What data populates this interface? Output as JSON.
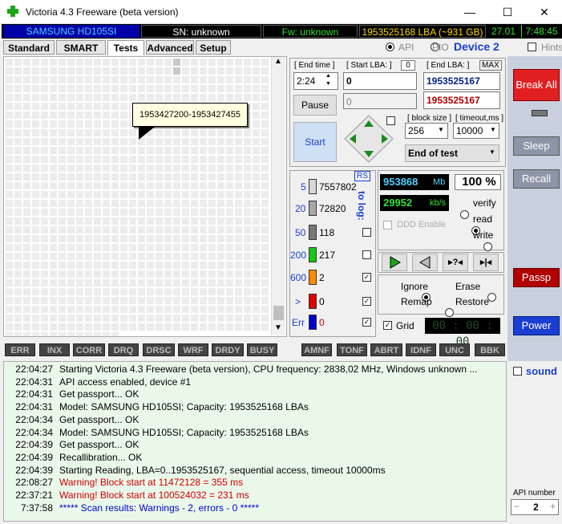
{
  "window": {
    "title": "Victoria 4.3 Freeware (beta version)",
    "minimize": "—",
    "maximize": "☐",
    "close": "✕"
  },
  "info": {
    "model": "SAMSUNG HD105SI",
    "serial": "SN: unknown",
    "firmware": "Fw: unknown",
    "capacity": "1953525168 LBA (~931 GB)",
    "version": "27.01",
    "time": "7:48:45"
  },
  "tabs": [
    "Standard",
    "SMART",
    "Tests",
    "Advanced",
    "Setup"
  ],
  "options": {
    "api": "API",
    "pio": "PIO",
    "device": "Device 2",
    "hints": "Hints"
  },
  "map": {
    "tooltip": "1953427200-1953427455"
  },
  "controls": {
    "end_time_label": "[ End time ]",
    "end_time": "2:24",
    "start_lba_label": "[ Start LBA: ]",
    "start_lba_sub": "0",
    "start_lba": "0",
    "end_lba_label": "[ End LBA: ]",
    "max_label": "MAX",
    "end_lba": "1953525167",
    "pause": "Pause",
    "current_lba": "0",
    "current_end": "1953525167",
    "start": "Start",
    "block_size_label": "[ block size ]",
    "block_size": "256",
    "timeout_label": "[ timeout,ms ]",
    "timeout": "10000",
    "end_mode": "End of test"
  },
  "counters": {
    "rs": "RS",
    "to_log": "to log:",
    "rows": [
      {
        "ms": "5",
        "count": "7557802",
        "color": "#d8d8d8"
      },
      {
        "ms": "20",
        "count": "72820",
        "color": "#a8a8a8"
      },
      {
        "ms": "50",
        "count": "118",
        "color": "#787878"
      },
      {
        "ms": "200",
        "count": "217",
        "color": "#18c818"
      },
      {
        "ms": "600",
        "count": "2",
        "color": "#ff8c00"
      },
      {
        "ms": ">",
        "count": "0",
        "color": "#e00000"
      },
      {
        "ms": "Err",
        "count": "0",
        "color": "#0000c8"
      }
    ]
  },
  "stats": {
    "mb": "953868",
    "mb_unit": "Mb",
    "percent": "100",
    "percent_unit": "%",
    "speed": "29952",
    "speed_unit": "kb/s",
    "ddd": "DDD Enable",
    "verify": "verify",
    "read": "read",
    "write": "write"
  },
  "actions": {
    "ignore": "Ignore",
    "erase": "Erase",
    "remap": "Remap",
    "restore": "Restore",
    "grid": "Grid",
    "timer": "00 : 00 : 00"
  },
  "side": {
    "break_all": "Break All",
    "sleep": "Sleep",
    "recall": "Recall",
    "passp": "Passp",
    "power": "Power",
    "sound": "sound",
    "api_number_label": "API number",
    "api_number": "2"
  },
  "errtabs": [
    "ERR",
    "INX",
    "CORR",
    "DRQ",
    "DRSC",
    "WRF",
    "DRDY",
    "BUSY",
    "AMNF",
    "TONF",
    "ABRT",
    "IDNF",
    "UNC",
    "BBK"
  ],
  "log": [
    {
      "time": "22:04:27",
      "msg": "Starting Victoria 4.3 Freeware (beta version), CPU frequency: 2838,02 MHz, Windows unknown ...",
      "color": "#000"
    },
    {
      "time": "22:04:31",
      "msg": "API access enabled, device #1",
      "color": "#000"
    },
    {
      "time": "22:04:31",
      "msg": "Get passport... OK",
      "color": "#000"
    },
    {
      "time": "22:04:31",
      "msg": "Model: SAMSUNG HD105SI; Capacity: 1953525168 LBAs",
      "color": "#000"
    },
    {
      "time": "22:04:34",
      "msg": "Get passport... OK",
      "color": "#000"
    },
    {
      "time": "22:04:34",
      "msg": "Model: SAMSUNG HD105SI; Capacity: 1953525168 LBAs",
      "color": "#000"
    },
    {
      "time": "22:04:39",
      "msg": "Get passport... OK",
      "color": "#000"
    },
    {
      "time": "22:04:39",
      "msg": "Recallibration... OK",
      "color": "#000"
    },
    {
      "time": "22:04:39",
      "msg": "Starting Reading, LBA=0..1953525167, sequential access, timeout 10000ms",
      "color": "#000"
    },
    {
      "time": "22:08:27",
      "msg": "Warning! Block start at 11472128 = 355 ms",
      "color": "#d00000"
    },
    {
      "time": "22:37:21",
      "msg": "Warning! Block start at 100524032 = 231 ms",
      "color": "#d00000"
    },
    {
      "time": "7:37:58",
      "msg": "***** Scan results: Warnings - 2, errors - 0 *****",
      "color": "#0000d0"
    }
  ]
}
